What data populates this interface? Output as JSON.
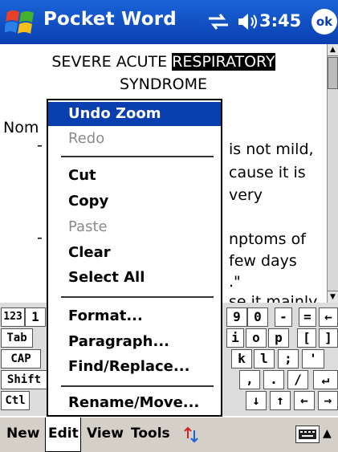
{
  "titlebar": {
    "app_title": "Pocket Word",
    "clock": "3:45",
    "ok_label": "ok"
  },
  "document": {
    "title_line1_normal": "SEVERE ACUTE ",
    "title_line1_highlight": "RESPIRATORY",
    "title_line2": "SYNDROME",
    "fragments": {
      "nom": "Nom",
      "l1": "is not mild,",
      "l2": "cause it is",
      "l3": "very",
      "l4": "nptoms of",
      "l5": "few days",
      "l6": ".\"",
      "l7": "se it mainly"
    }
  },
  "keyboard": {
    "row1_left": [
      "123",
      "1"
    ],
    "row1_right": [
      "9",
      "0",
      "-",
      "=",
      "←"
    ],
    "row2_left": [
      "Tab"
    ],
    "row2_right": [
      "i",
      "o",
      "p",
      "[",
      "]"
    ],
    "row3_left": [
      "CAP"
    ],
    "row3_right": [
      "k",
      "l",
      ";",
      "'"
    ],
    "row4_left": [
      "Shift"
    ],
    "row4_right": [
      ",",
      ".",
      "/",
      "↵"
    ],
    "row5_left": [
      "Ctl"
    ],
    "row5_right": [
      "↓",
      "↑",
      "←",
      "→"
    ]
  },
  "edit_menu": {
    "items": [
      {
        "label": "Undo Zoom",
        "state": "active"
      },
      {
        "label": "Redo",
        "state": "disabled"
      },
      {
        "label": "Cut",
        "state": "enabled"
      },
      {
        "label": "Copy",
        "state": "enabled"
      },
      {
        "label": "Paste",
        "state": "disabled"
      },
      {
        "label": "Clear",
        "state": "enabled"
      },
      {
        "label": "Select All",
        "state": "enabled"
      },
      {
        "label": "Format...",
        "state": "enabled"
      },
      {
        "label": "Paragraph...",
        "state": "enabled"
      },
      {
        "label": "Find/Replace...",
        "state": "enabled"
      },
      {
        "label": "Rename/Move...",
        "state": "enabled"
      }
    ]
  },
  "menubar": {
    "new": "New",
    "edit": "Edit",
    "view": "View",
    "tools": "Tools"
  },
  "icons": {
    "start": "windows-flag-icon",
    "sync": "sync-arrows-icon",
    "volume": "speaker-icon",
    "ok": "ok-button",
    "input": "keyboard-icon",
    "updown": "up-down-arrows-icon"
  },
  "colors": {
    "titlebar": "#0a3fb0",
    "selection": "#0a3fb0",
    "menu_bg": "#d4d0c8"
  }
}
